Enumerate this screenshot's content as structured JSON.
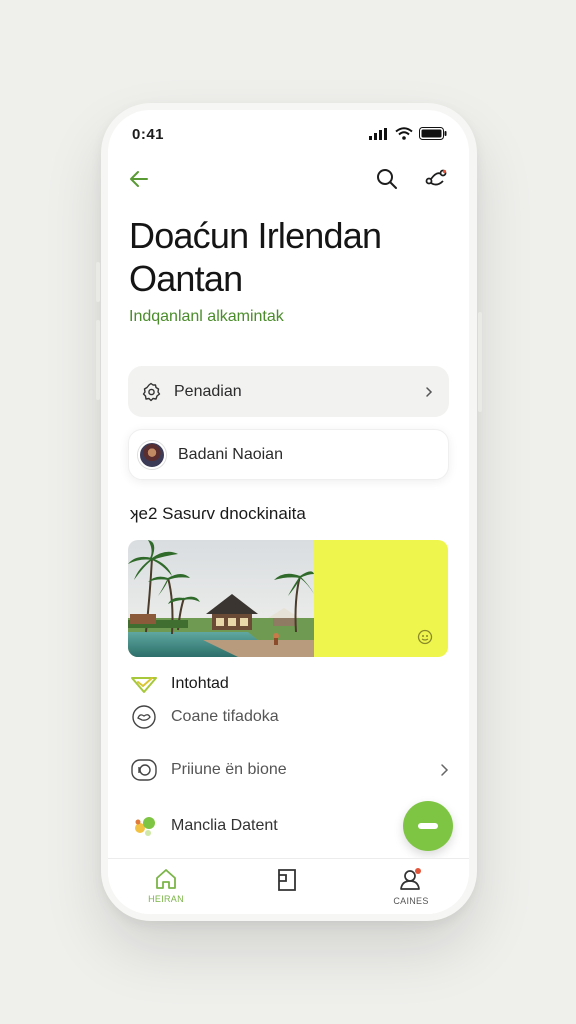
{
  "status_bar": {
    "time": "0:41"
  },
  "header": {
    "back_icon": "arrow-left-icon",
    "search_icon": "search-icon",
    "share_icon": "share-icon"
  },
  "page": {
    "title": "Doaćun Irlendan Oantan",
    "subtitle": "Indqanlanl alkamintak"
  },
  "rows": [
    {
      "icon": "gear-icon",
      "label": "Penadian"
    },
    {
      "icon": "avatar",
      "label": "Badani Naoian"
    }
  ],
  "section": {
    "heading": "ʞe2 Sasuɾv dnockinaita"
  },
  "list": [
    {
      "icon": "check-triangle-icon",
      "label": "Intohtad"
    },
    {
      "icon": "chat-bubble-icon",
      "label": "Coane tifadoka"
    },
    {
      "icon": "camera-icon",
      "label": "Priiune ën bione"
    },
    {
      "icon": "apps-icon",
      "label": "Manclia Datent"
    }
  ],
  "tabs": [
    {
      "icon": "home-icon",
      "label": "HEIRAN"
    },
    {
      "icon": "book-icon",
      "label": ""
    },
    {
      "icon": "profile-icon",
      "label": "CAINES"
    }
  ],
  "colors": {
    "accent": "#4a8c2a",
    "fab": "#7fc544",
    "highlight": "#eef54d"
  }
}
